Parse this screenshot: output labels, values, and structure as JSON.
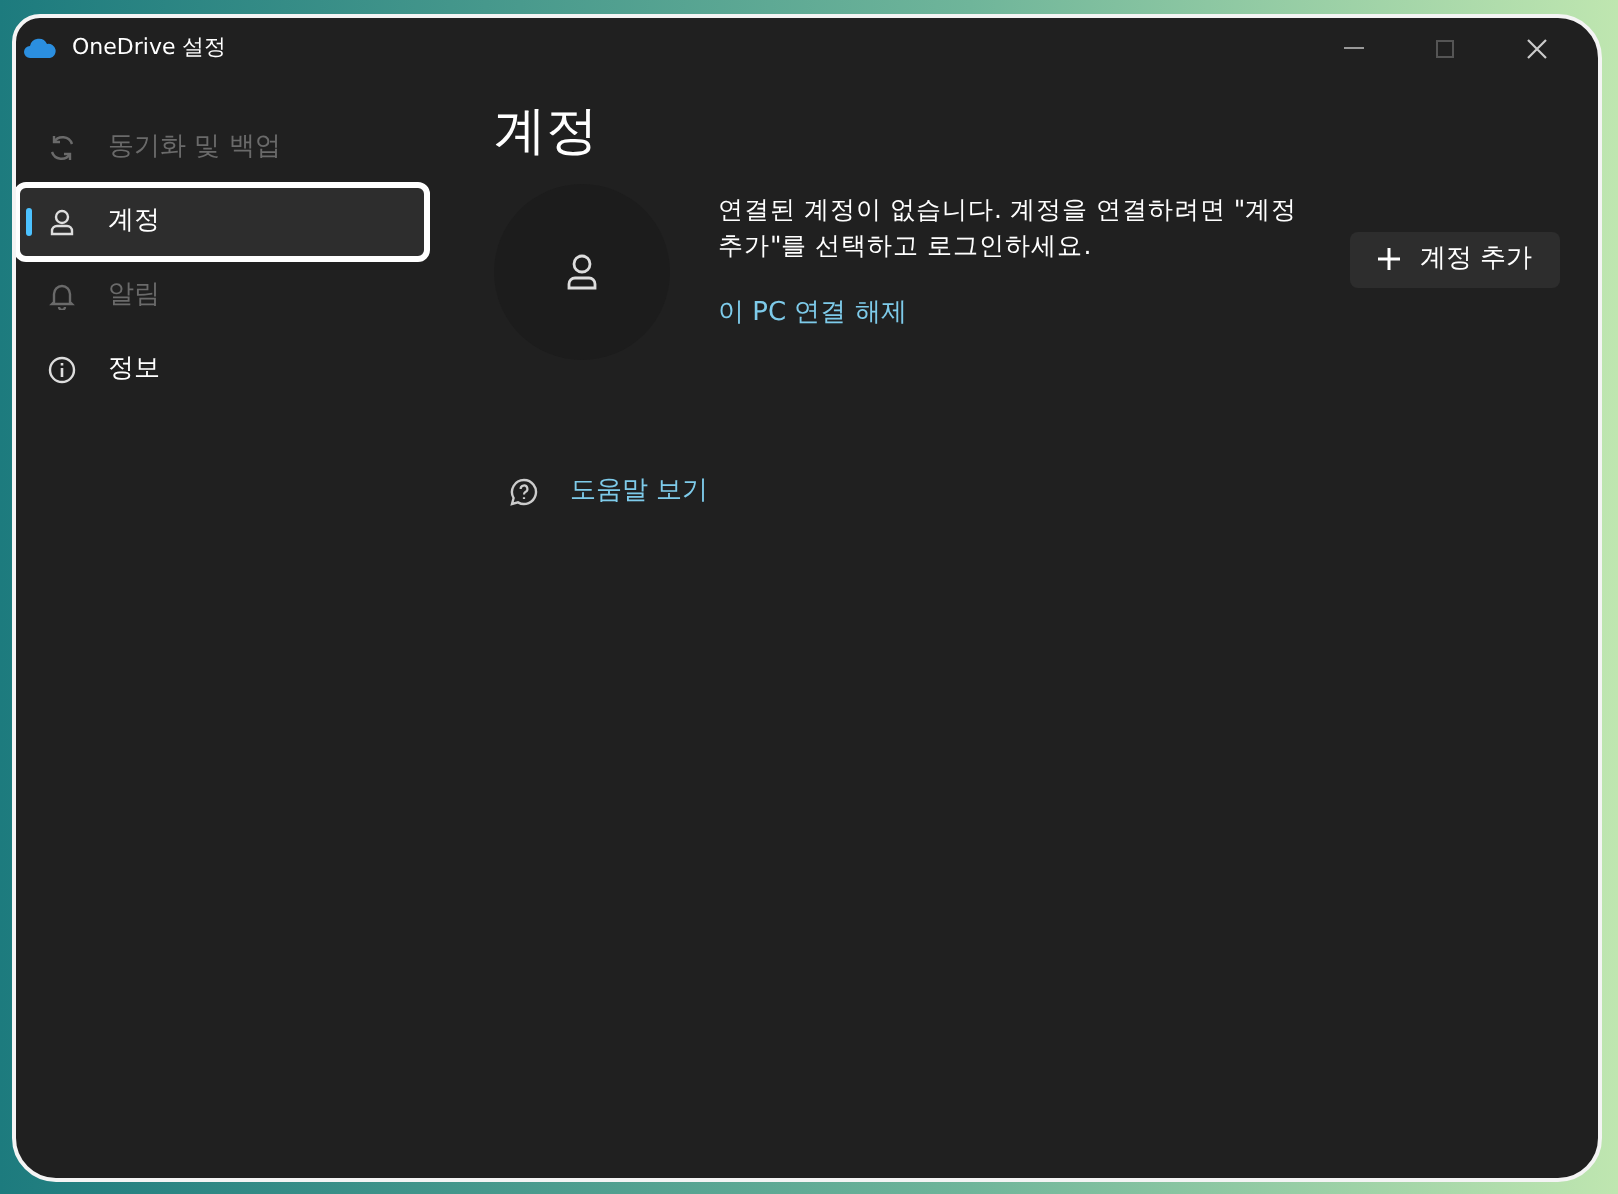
{
  "window": {
    "title": "OneDrive 설정"
  },
  "sidebar": {
    "items": [
      {
        "label": "동기화 및 백업",
        "selected": false,
        "disabled": true,
        "highlighted": false
      },
      {
        "label": "계정",
        "selected": true,
        "disabled": false,
        "highlighted": true
      },
      {
        "label": "알림",
        "selected": false,
        "disabled": true,
        "highlighted": false
      },
      {
        "label": "정보",
        "selected": false,
        "disabled": false,
        "highlighted": false
      }
    ]
  },
  "content": {
    "heading": "계정",
    "message": "연결된 계정이 없습니다. 계정을 연결하려면 \"계정 추가\"를 선택하고 로그인하세요.",
    "unlink_link": "이 PC 연결 해제",
    "add_button": "계정 추가",
    "help_link": "도움말 보기"
  }
}
